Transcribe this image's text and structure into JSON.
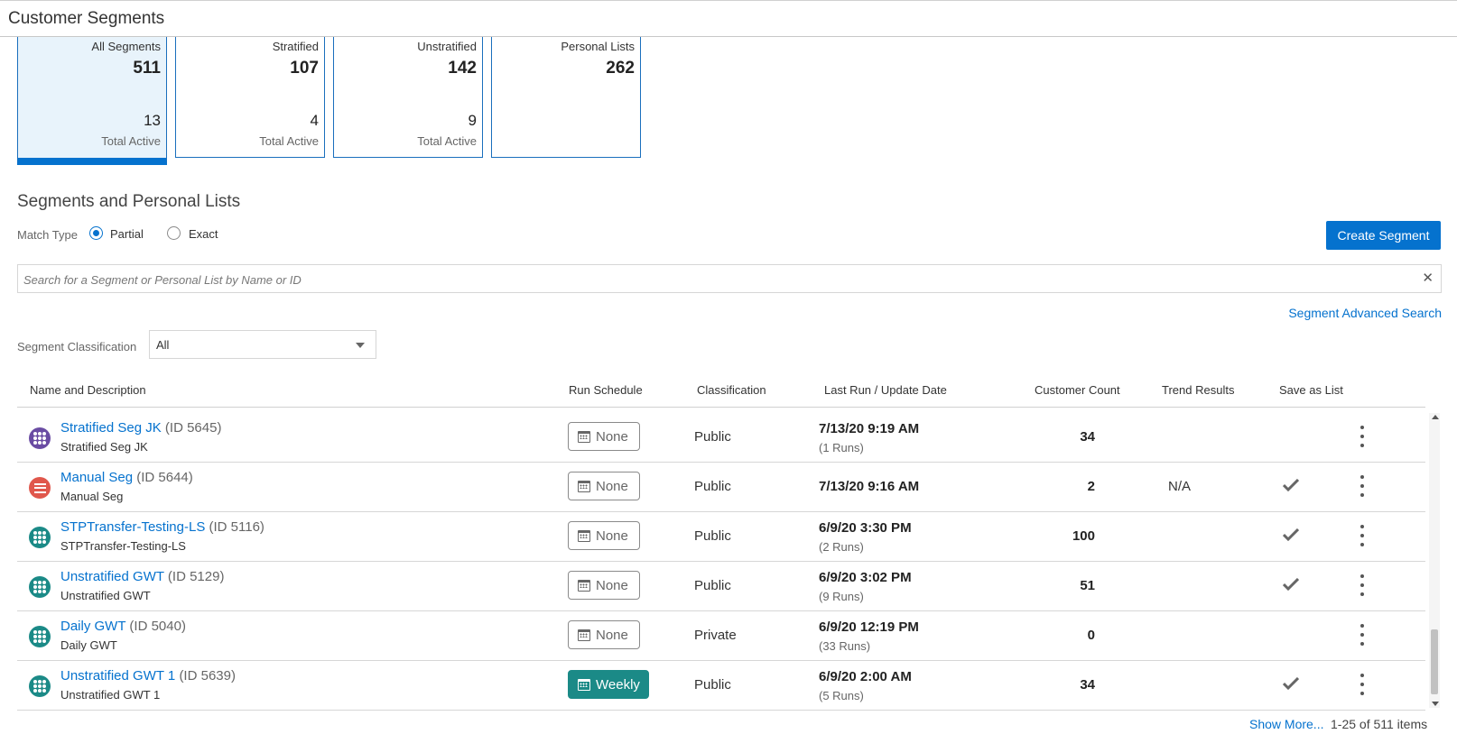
{
  "header": {
    "title": "Customer Segments"
  },
  "stats": [
    {
      "label": "All Segments",
      "count": "511",
      "active_count": "13",
      "active_label": "Total Active",
      "selected": true
    },
    {
      "label": "Stratified",
      "count": "107",
      "active_count": "4",
      "active_label": "Total Active",
      "selected": false
    },
    {
      "label": "Unstratified",
      "count": "142",
      "active_count": "9",
      "active_label": "Total Active",
      "selected": false
    },
    {
      "label": "Personal Lists",
      "count": "262",
      "active_count": "",
      "active_label": "",
      "selected": false
    }
  ],
  "section": {
    "title": "Segments and Personal Lists",
    "match_type_label": "Match Type",
    "match_options": [
      "Partial",
      "Exact"
    ],
    "match_selected": "Partial",
    "create_button": "Create Segment"
  },
  "search": {
    "placeholder": "Search for a Segment or Personal List by Name or ID",
    "value": ""
  },
  "advanced_search": "Segment Advanced Search",
  "classification_filter": {
    "label": "Segment Classification",
    "value": "All"
  },
  "table": {
    "columns": [
      "Name and Description",
      "Run Schedule",
      "Classification",
      "Last Run / Update Date",
      "Customer Count",
      "Trend Results",
      "Save as List"
    ],
    "rows": [
      {
        "name": "Stratified Seg JK",
        "id": "(ID 5645)",
        "desc": "Stratified Seg JK",
        "icon": "stratified-segment-icon",
        "icon_color": "#6a4ca3",
        "schedule": "None",
        "classification": "Public",
        "date": "7/13/20 9:19 AM",
        "runs": "(1 Runs)",
        "count": "34",
        "trend": "",
        "saved": false
      },
      {
        "name": "Manual Seg",
        "id": "(ID 5644)",
        "desc": "Manual Seg",
        "icon": "manual-segment-icon",
        "icon_color": "#e0574c",
        "schedule": "None",
        "classification": "Public",
        "date": "7/13/20 9:16 AM",
        "runs": "",
        "count": "2",
        "trend": "N/A",
        "saved": true
      },
      {
        "name": "STPTransfer-Testing-LS",
        "id": "(ID 5116)",
        "desc": "STPTransfer-Testing-LS",
        "icon": "unstratified-segment-icon",
        "icon_color": "#1b8a87",
        "schedule": "None",
        "classification": "Public",
        "date": "6/9/20 3:30 PM",
        "runs": "(2 Runs)",
        "count": "100",
        "trend": "",
        "saved": true
      },
      {
        "name": "Unstratified GWT",
        "id": "(ID 5129)",
        "desc": "Unstratified GWT",
        "icon": "unstratified-segment-icon",
        "icon_color": "#1b8a87",
        "schedule": "None",
        "classification": "Public",
        "date": "6/9/20 3:02 PM",
        "runs": "(9 Runs)",
        "count": "51",
        "trend": "",
        "saved": true
      },
      {
        "name": "Daily GWT",
        "id": "(ID 5040)",
        "desc": "Daily GWT",
        "icon": "unstratified-segment-icon",
        "icon_color": "#1b8a87",
        "schedule": "None",
        "classification": "Private",
        "date": "6/9/20 12:19 PM",
        "runs": "(33 Runs)",
        "count": "0",
        "trend": "",
        "saved": false
      },
      {
        "name": "Unstratified GWT 1",
        "id": "(ID 5639)",
        "desc": "Unstratified GWT 1",
        "icon": "unstratified-segment-icon",
        "icon_color": "#1b8a87",
        "schedule": "Weekly",
        "classification": "Public",
        "date": "6/9/20 2:00 AM",
        "runs": "(5 Runs)",
        "count": "34",
        "trend": "",
        "saved": true
      }
    ]
  },
  "footer": {
    "show_more": "Show More...",
    "paging": "1-25 of 511 items"
  }
}
